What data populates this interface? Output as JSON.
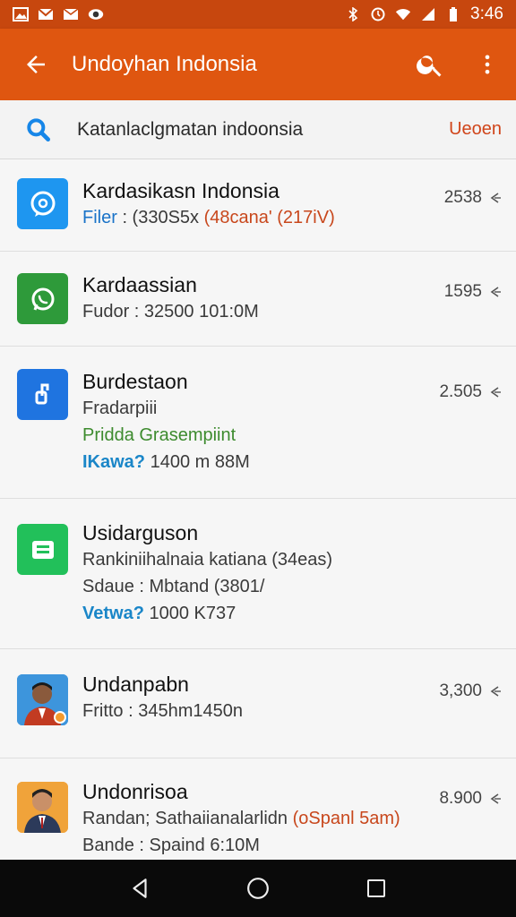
{
  "status_bar": {
    "time": "3:46",
    "left_icons": [
      "photo-icon",
      "gmail-icon",
      "mail-icon",
      "ghost-icon"
    ],
    "right_icons": [
      "bluetooth-icon",
      "alarm-icon",
      "wifi-icon",
      "signal-icon",
      "battery-icon"
    ]
  },
  "app_bar": {
    "title": "Undoyhan Indonsia"
  },
  "search": {
    "query": "Katanlaclgmatan indoonsia",
    "action_label": "Ueoen"
  },
  "items": [
    {
      "title": "Kardasikasn Indonsia",
      "icon": "chat-bubble-icon",
      "icon_color": "#1e96f0",
      "lines": [
        {
          "label": "Filer",
          "text": " : (330S5x ",
          "highlight": "(48cana' (217iV)"
        }
      ],
      "meta": "2538"
    },
    {
      "title": "Kardaassian",
      "icon": "whatsapp-icon",
      "icon_color": "#2e9a3a",
      "lines": [
        {
          "text": "Fudor : 32500 101:0M"
        }
      ],
      "meta": "1595"
    },
    {
      "title": "Burdestaon",
      "icon": "share-icon",
      "icon_color": "#1f74e0",
      "lines": [
        {
          "text": "Fradarpiii"
        },
        {
          "text": "Pridda Grasempiint",
          "style": "green"
        },
        {
          "label": "IKawa?",
          "text": "  1400 m 88M",
          "label_style": "blue-b"
        }
      ],
      "meta": "2.505"
    },
    {
      "title": "Usidarguson",
      "icon": "message-icon",
      "icon_color": "#22c05a",
      "lines": [
        {
          "text": "Rankiniihalnaia katiana (34eas)"
        },
        {
          "text": "Sdaue : Mbtand (3801/"
        },
        {
          "label": "Vetwa?",
          "text": "  1000 K737",
          "label_style": "blue-b"
        }
      ],
      "meta": ""
    },
    {
      "title": "Undanpabn",
      "icon": "person-avatar-icon",
      "icon_color": "#2a8ad8",
      "lines": [
        {
          "text": "Fritto : 345hm1450n"
        }
      ],
      "meta": "3,300"
    },
    {
      "title": "Undonrisoa",
      "icon": "person-avatar-icon",
      "icon_color": "#f0a33a",
      "lines": [
        {
          "text": "Randan; Sathaiianalarlidn ",
          "highlight": "(oSpanl 5am)"
        },
        {
          "text": "Bande : Spaind 6:10M"
        }
      ],
      "meta": "8.900"
    }
  ],
  "nav_bar": {
    "buttons": [
      "back-icon",
      "home-icon",
      "recents-icon"
    ]
  },
  "colors": {
    "status_bar": "#c7470e",
    "app_bar": "#df5610",
    "accent": "#d0451a",
    "link_blue": "#1a73c8"
  }
}
